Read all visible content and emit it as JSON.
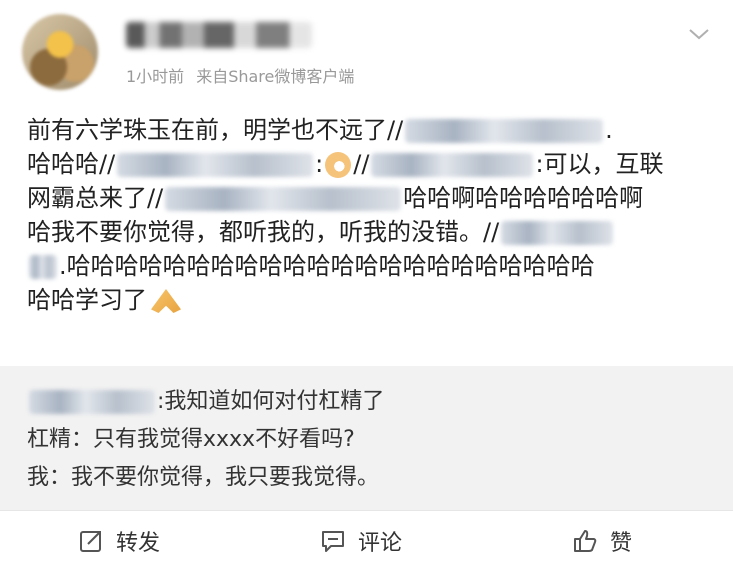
{
  "header": {
    "meta": {
      "time": "1小时前",
      "source": "来自Share微博客户端"
    },
    "icons": {
      "avatar": "avatar-image",
      "more": "chevron-down-icon"
    }
  },
  "post": {
    "lines": [
      [
        "前有六学珠玉在前，明学也不远了//",
        "",
        "."
      ],
      [
        "哈哈哈//",
        "",
        ":",
        "",
        "//",
        "",
        ":可以，互联"
      ],
      [
        "网霸总来了//",
        "",
        "哈哈啊哈哈哈哈哈哈啊"
      ],
      [
        "哈我不要你觉得，都听我的，听我的没错。//",
        ""
      ],
      [
        "",
        ".哈哈哈哈哈哈哈哈哈哈哈哈哈哈哈哈哈哈哈哈哈哈"
      ],
      [
        "哈哈学习了",
        ""
      ]
    ]
  },
  "repost": {
    "line1": ":我知道如何对付杠精了",
    "line2": "杠精：只有我觉得xxxx不好看吗?",
    "line3": "我：我不要你觉得，我只要我觉得。"
  },
  "actions": {
    "repost": "转发",
    "comment": "评论",
    "like": "赞"
  },
  "colors": {
    "meta": "#999999",
    "text": "#222222",
    "repost_bg": "#f2f2f2"
  }
}
